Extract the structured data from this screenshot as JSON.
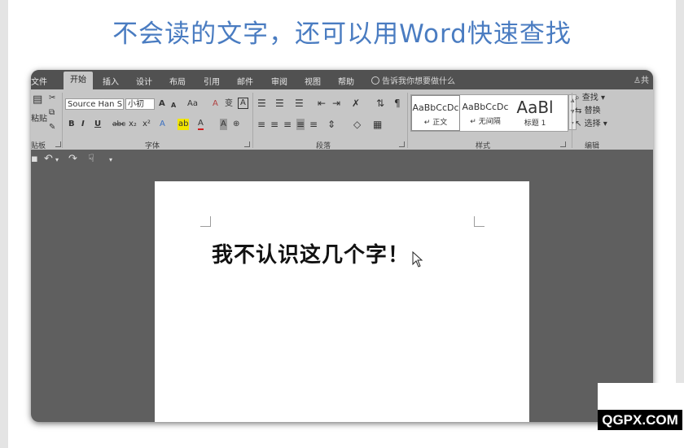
{
  "headline": "不会读的文字，还可以用Word快速查找",
  "ribbon": {
    "tabs": [
      "文件",
      "开始",
      "插入",
      "设计",
      "布局",
      "引用",
      "邮件",
      "审阅",
      "视图",
      "帮助"
    ],
    "active_tab": "开始",
    "tell_me": "告诉我你想要做什么",
    "share_label": "共",
    "clipboard": {
      "paste_label": "粘贴",
      "group_label": "贴板"
    },
    "font": {
      "name": "Source Han S",
      "size": "小初",
      "grow": "A",
      "shrink": "A",
      "case": "Aa",
      "bold": "B",
      "italic": "I",
      "underline": "U",
      "strike": "abc",
      "subscript": "x₂",
      "superscript": "x²",
      "effects": "A",
      "highlight": "ab",
      "color": "A",
      "shading": "A",
      "enclose": "⊕",
      "clear_format": "A",
      "phonetic": "变",
      "char_border": "A",
      "group_label": "字体"
    },
    "paragraph": {
      "group_label": "段落"
    },
    "styles": {
      "items": [
        {
          "preview": "AaBbCcDc",
          "name": "↵ 正文"
        },
        {
          "preview": "AaBbCcDc",
          "name": "↵ 无间隔"
        },
        {
          "preview": "AaBl",
          "name": "标题 1"
        }
      ],
      "group_label": "样式"
    },
    "editing": {
      "find": "查找",
      "replace": "替换",
      "select": "选择",
      "group_label": "编辑"
    }
  },
  "document": {
    "text": "我不认识这几个字！"
  },
  "watermark": "QGPX.COM",
  "colors": {
    "headline": "#4a7cc1",
    "ribbon_tabs": "#515151",
    "ribbon_body": "#c6c6c6",
    "workspace": "#5f5f5f"
  }
}
